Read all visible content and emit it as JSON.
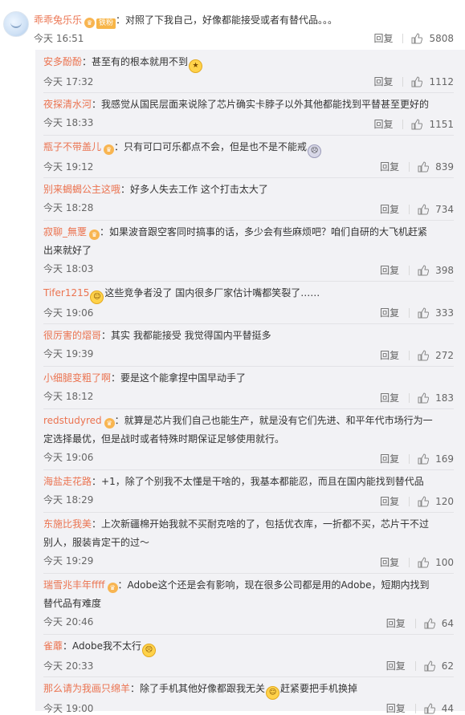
{
  "main_comment": {
    "username": "乖乖兔乐乐",
    "badge": "铁粉",
    "text": "：对照了下我自己，好像都能接受或者有替代品。。。",
    "time": "今天 16:51",
    "reply": "回复",
    "likes": "5808"
  },
  "replies": [
    {
      "username": "安多酚酚",
      "text": "：甚至有的根本就用不到",
      "emoji": "star",
      "time": "今天 17:32",
      "reply": "回复",
      "likes": "1112"
    },
    {
      "username": "夜探清水河",
      "text": "：我感觉从国民层面来说除了芯片确实卡脖子以外其他都能找到平替甚至更好的",
      "time": "今天 18:33",
      "reply": "回复",
      "likes": "1151"
    },
    {
      "username": "瓶子不带盖儿",
      "vip": true,
      "text": "：只有可口可乐都点不会，但是也不是不能戒",
      "emoji": "cry",
      "time": "今天 19:12",
      "reply": "回复",
      "likes": "839"
    },
    {
      "username": "别来蝎蝎公主这哦",
      "text": "：好多人失去工作 这个打击太大了",
      "time": "今天 18:28",
      "reply": "回复",
      "likes": "734"
    },
    {
      "username": "寂聊_無覂",
      "vip": true,
      "text": "：如果波音跟空客同时搞事的话，多少会有些麻烦吧？咱们自研的大飞机赶紧出来就好了",
      "time": "今天 18:03",
      "reply": "回复",
      "likes": "398"
    },
    {
      "username": "Tifer1215",
      "emoji_before": "laugh",
      "text": "这些竞争者没了 国内很多厂家估计嘴都笑裂了……",
      "time": "今天 19:06",
      "reply": "回复",
      "likes": "333"
    },
    {
      "username": "很厉害的熠哥",
      "text": "：其实 我都能接受 我觉得国内平替挺多",
      "time": "今天 19:39",
      "reply": "回复",
      "likes": "272"
    },
    {
      "username": "小细腿变粗了啊",
      "text": "：要是这个能拿捏中国早动手了",
      "time": "今天 18:12",
      "reply": "回复",
      "likes": "183"
    },
    {
      "username": "redstudyred",
      "vip": true,
      "text": "：就算是芯片我们自己也能生产，就是没有它们先进、和平年代市场行为一定选择最优，但是战时或者特殊时期保证足够使用就行。",
      "time": "今天 19:06",
      "reply": "回复",
      "likes": "169"
    },
    {
      "username": "海盐走花路",
      "text": "：+1，除了个别我不太懂是干啥的，我基本都能忍，而且在国内能找到替代品",
      "time": "今天 18:29",
      "reply": "回复",
      "likes": "120"
    },
    {
      "username": "东施比我美",
      "text": "：上次新疆棉开始我就不买耐克啥的了，包括优衣库，一折都不买，芯片干不过别人，服装肯定干的过～",
      "time": "今天 19:29",
      "reply": "回复",
      "likes": "100"
    },
    {
      "username": "瑞雪兆丰年ffff",
      "vip": true,
      "text": "：Adobe这个还是会有影响，现在很多公司都是用的Adobe，短期内找到替代品有难度",
      "time": "今天 20:46",
      "reply": "回复",
      "likes": "64"
    },
    {
      "username": "雀蘼",
      "text": "：Adobe我不太行",
      "emoji": "sad",
      "time": "今天 20:33",
      "reply": "回复",
      "likes": "62"
    },
    {
      "username": "那么请为我画只绵羊",
      "text": "：除了手机其他好像都跟我无关",
      "emoji_mid": "laugh",
      "text2": "赶紧要把手机换掉",
      "time": "今天 19:00",
      "reply": "回复",
      "likes": "44"
    }
  ]
}
